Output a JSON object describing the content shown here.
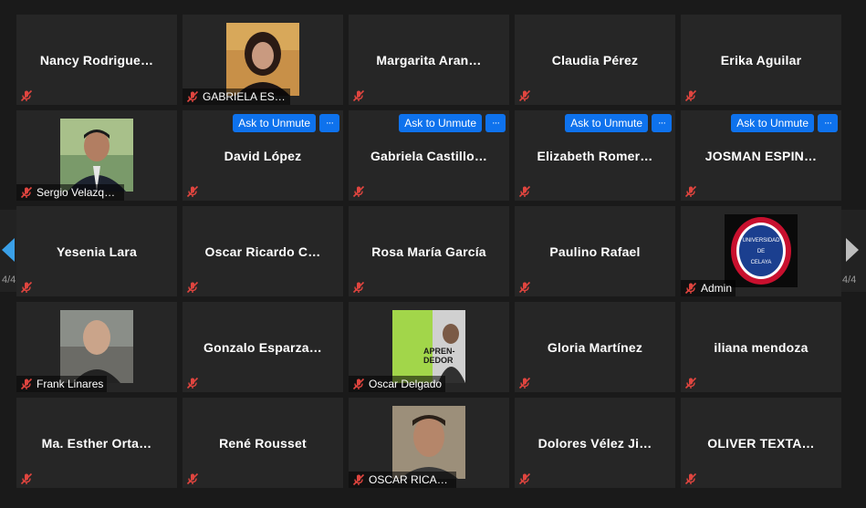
{
  "colors": {
    "accent": "#0e72ed",
    "tile_bg": "#262626",
    "muted_mic": "#e0453f"
  },
  "participants": [
    {
      "name": "Nancy  Rodrigue…",
      "has_photo": false
    },
    {
      "name": "GABRIELA ESPIN…",
      "has_photo": true,
      "photo": "woman-portrait"
    },
    {
      "name": "Margarita  Aran…",
      "has_photo": false
    },
    {
      "name": "Claudia Pérez",
      "has_photo": false
    },
    {
      "name": "Erika Aguilar",
      "has_photo": false
    },
    {
      "name": "Sergio Velazqu…",
      "has_photo": true,
      "photo": "man-suit-portrait"
    },
    {
      "name": "David López",
      "has_photo": false,
      "ask_to_unmute": true
    },
    {
      "name": "Gabriela  Castillo…",
      "has_photo": false,
      "ask_to_unmute": true
    },
    {
      "name": "Elizabeth  Romer…",
      "has_photo": false,
      "ask_to_unmute": true
    },
    {
      "name": "JOSMAN  ESPIN…",
      "has_photo": false,
      "ask_to_unmute": true
    },
    {
      "name": "Yesenia Lara",
      "has_photo": false
    },
    {
      "name": "Oscar  Ricardo  C…",
      "has_photo": false
    },
    {
      "name": "Rosa María García",
      "has_photo": false
    },
    {
      "name": "Paulino Rafael",
      "has_photo": false
    },
    {
      "name": "Admin",
      "has_photo": true,
      "photo": "university-seal"
    },
    {
      "name": "Frank Linares",
      "has_photo": true,
      "photo": "bald-man-portrait"
    },
    {
      "name": "Gonzalo  Esparza…",
      "has_photo": false
    },
    {
      "name": "Oscar Delgado",
      "has_photo": true,
      "photo": "book-cover"
    },
    {
      "name": "Gloria Martínez",
      "has_photo": false
    },
    {
      "name": "iliana mendoza",
      "has_photo": false
    },
    {
      "name": "Ma.  Esther  Orta…",
      "has_photo": false
    },
    {
      "name": "René Rousset",
      "has_photo": false
    },
    {
      "name": "OSCAR RICARD…",
      "has_photo": true,
      "photo": "man-portrait"
    },
    {
      "name": "Dolores  Vélez  Ji…",
      "has_photo": false
    },
    {
      "name": "OLIVER  TEXTA…",
      "has_photo": false
    }
  ],
  "ask_to_unmute_label": "Ask to Unmute",
  "more_label": "···",
  "seal_text": {
    "top": "UNIVERSIDAD",
    "middle": "DE",
    "bottom": "CELAYA"
  },
  "book_text": {
    "line1": "APREN-",
    "line2": "DEDOR"
  },
  "pagination": {
    "left": "4/4",
    "right": "4/4"
  }
}
